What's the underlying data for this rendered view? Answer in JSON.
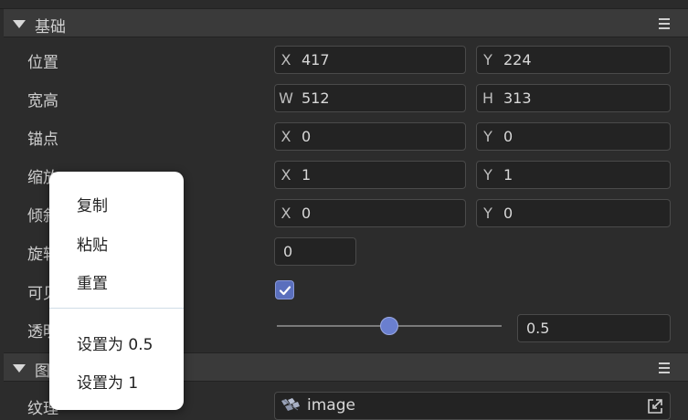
{
  "sections": {
    "basic": {
      "title": "基础"
    },
    "image": {
      "title": "图"
    }
  },
  "rows": {
    "position": {
      "label": "位置",
      "a_axis": "X",
      "a_val": "417",
      "b_axis": "Y",
      "b_val": "224"
    },
    "size": {
      "label": "宽高",
      "a_axis": "W",
      "a_val": "512",
      "b_axis": "H",
      "b_val": "313"
    },
    "anchor": {
      "label": "锚点",
      "a_axis": "X",
      "a_val": "0",
      "b_axis": "Y",
      "b_val": "0"
    },
    "scale": {
      "label": "缩放",
      "a_axis": "X",
      "a_val": "1",
      "b_axis": "Y",
      "b_val": "1"
    },
    "skew": {
      "label": "倾斜",
      "a_axis": "X",
      "a_val": "0",
      "b_axis": "Y",
      "b_val": "0"
    },
    "rotation": {
      "label": "旋转",
      "val": "0"
    },
    "visible": {
      "label": "可见",
      "checked": true
    },
    "opacity": {
      "label": "透明",
      "val": "0.5",
      "level": 0.5
    },
    "texture": {
      "label": "纹理",
      "value": "image"
    }
  },
  "context_menu": {
    "copy": "复制",
    "paste": "粘贴",
    "reset": "重置",
    "set_half": "设置为 0.5",
    "set_one": "设置为 1"
  },
  "colors": {
    "accent": "#6a7fcf",
    "panel": "#2c2c2c",
    "header": "#3a3a3a",
    "field": "#232323"
  },
  "icons": {
    "section_toggle": "triangle-down-icon",
    "section_menu": "hamburger-icon",
    "texture": "image-icon",
    "locate": "locate-icon",
    "check": "check-icon"
  }
}
